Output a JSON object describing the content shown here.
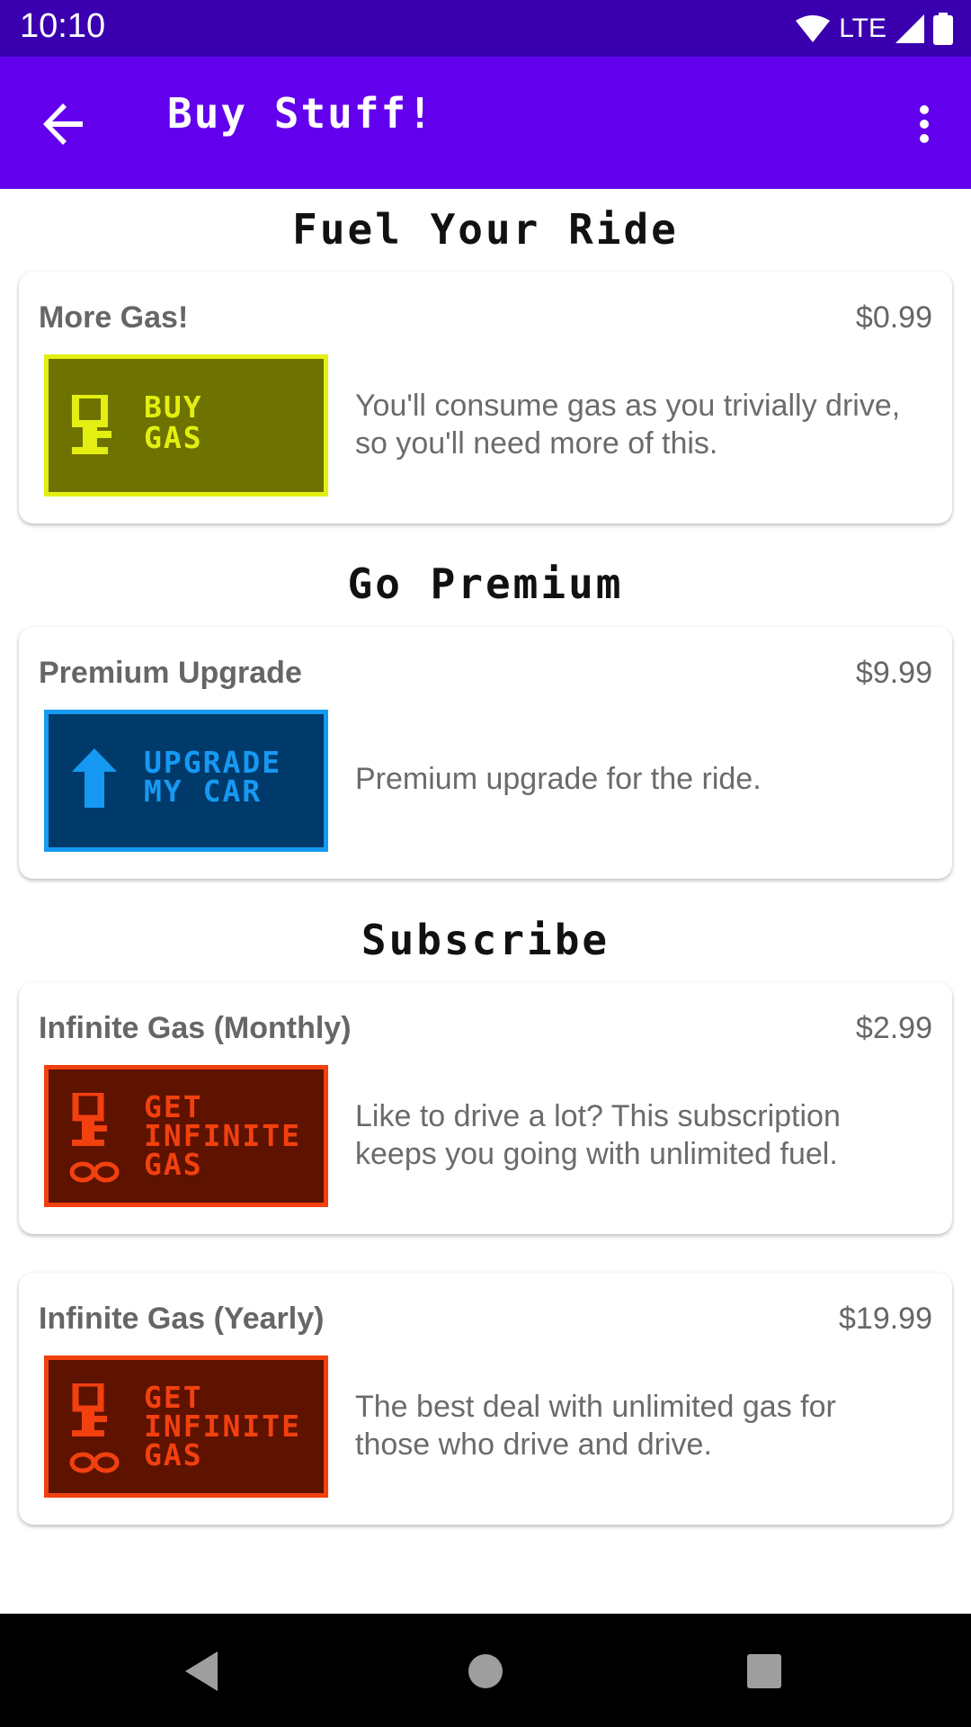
{
  "status_bar": {
    "time": "10:10",
    "network": "LTE"
  },
  "app_bar": {
    "title": "Buy Stuff!"
  },
  "sections": [
    {
      "title": "Fuel Your Ride",
      "items": [
        {
          "name": "More Gas!",
          "price": "$0.99",
          "badge_lines": [
            "BUY",
            "GAS"
          ],
          "description": "You'll consume gas as you trivially drive, so you'll need more of this."
        }
      ]
    },
    {
      "title": "Go Premium",
      "items": [
        {
          "name": "Premium Upgrade",
          "price": "$9.99",
          "badge_lines": [
            "UPGRADE",
            "MY CAR"
          ],
          "description": "Premium upgrade for the ride."
        }
      ]
    },
    {
      "title": "Subscribe",
      "items": [
        {
          "name": "Infinite Gas (Monthly)",
          "price": "$2.99",
          "badge_lines": [
            "GET",
            "INFINITE",
            "GAS"
          ],
          "description": "Like to drive a lot? This subscription keeps you going with unlimited fuel."
        },
        {
          "name": "Infinite Gas (Yearly)",
          "price": "$19.99",
          "badge_lines": [
            "GET",
            "INFINITE",
            "GAS"
          ],
          "description": "The best deal with unlimited gas for those who drive and drive."
        }
      ]
    }
  ],
  "colors": {
    "status_bar": "#3a00b0",
    "app_bar": "#6200ee",
    "gas_badge_bg": "#6d7200",
    "gas_badge_fg": "#e3ef11",
    "premium_badge_bg": "#003a6b",
    "premium_badge_fg": "#1699f2",
    "infinite_badge_bg": "#5e1200",
    "infinite_badge_fg": "#f2400f"
  }
}
